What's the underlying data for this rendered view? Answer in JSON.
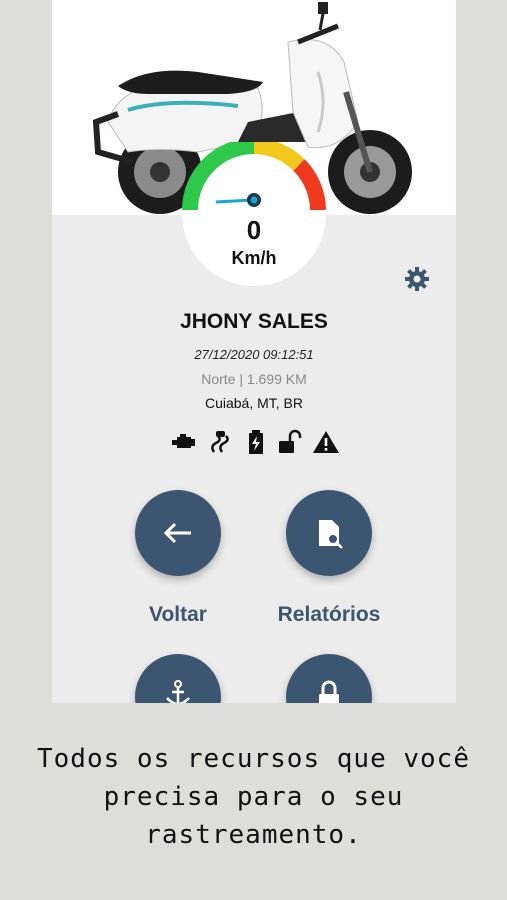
{
  "colors": {
    "page_background": "#dcdfd8",
    "panel_background": "#ececec",
    "primary": "#3c5671",
    "gauge_green": "#2ec84a",
    "gauge_yellow": "#f2c81c",
    "gauge_red": "#ef3a1e"
  },
  "gauge": {
    "value": "0",
    "unit": "Km/h"
  },
  "settings": {
    "icon": "gear-icon"
  },
  "vehicle": {
    "image": "motorcycle-image",
    "owner": "JHONY SALES",
    "datetime": "27/12/2020 09:12:51",
    "direction": "Norte | 1.699 KM",
    "location": "Cuiabá, MT, BR"
  },
  "status_icons": [
    "engine-icon",
    "road-icon",
    "battery-icon",
    "unlock-icon",
    "warning-icon"
  ],
  "actions": [
    {
      "label": "Voltar",
      "icon": "arrow-left-icon"
    },
    {
      "label": "Relatórios",
      "icon": "report-search-icon"
    },
    {
      "label": "",
      "icon": "anchor-icon"
    },
    {
      "label": "",
      "icon": "lock-icon"
    }
  ],
  "caption": {
    "line1": "Todos os recursos que você",
    "line2": "precisa para o seu",
    "line3": "rastreamento."
  }
}
